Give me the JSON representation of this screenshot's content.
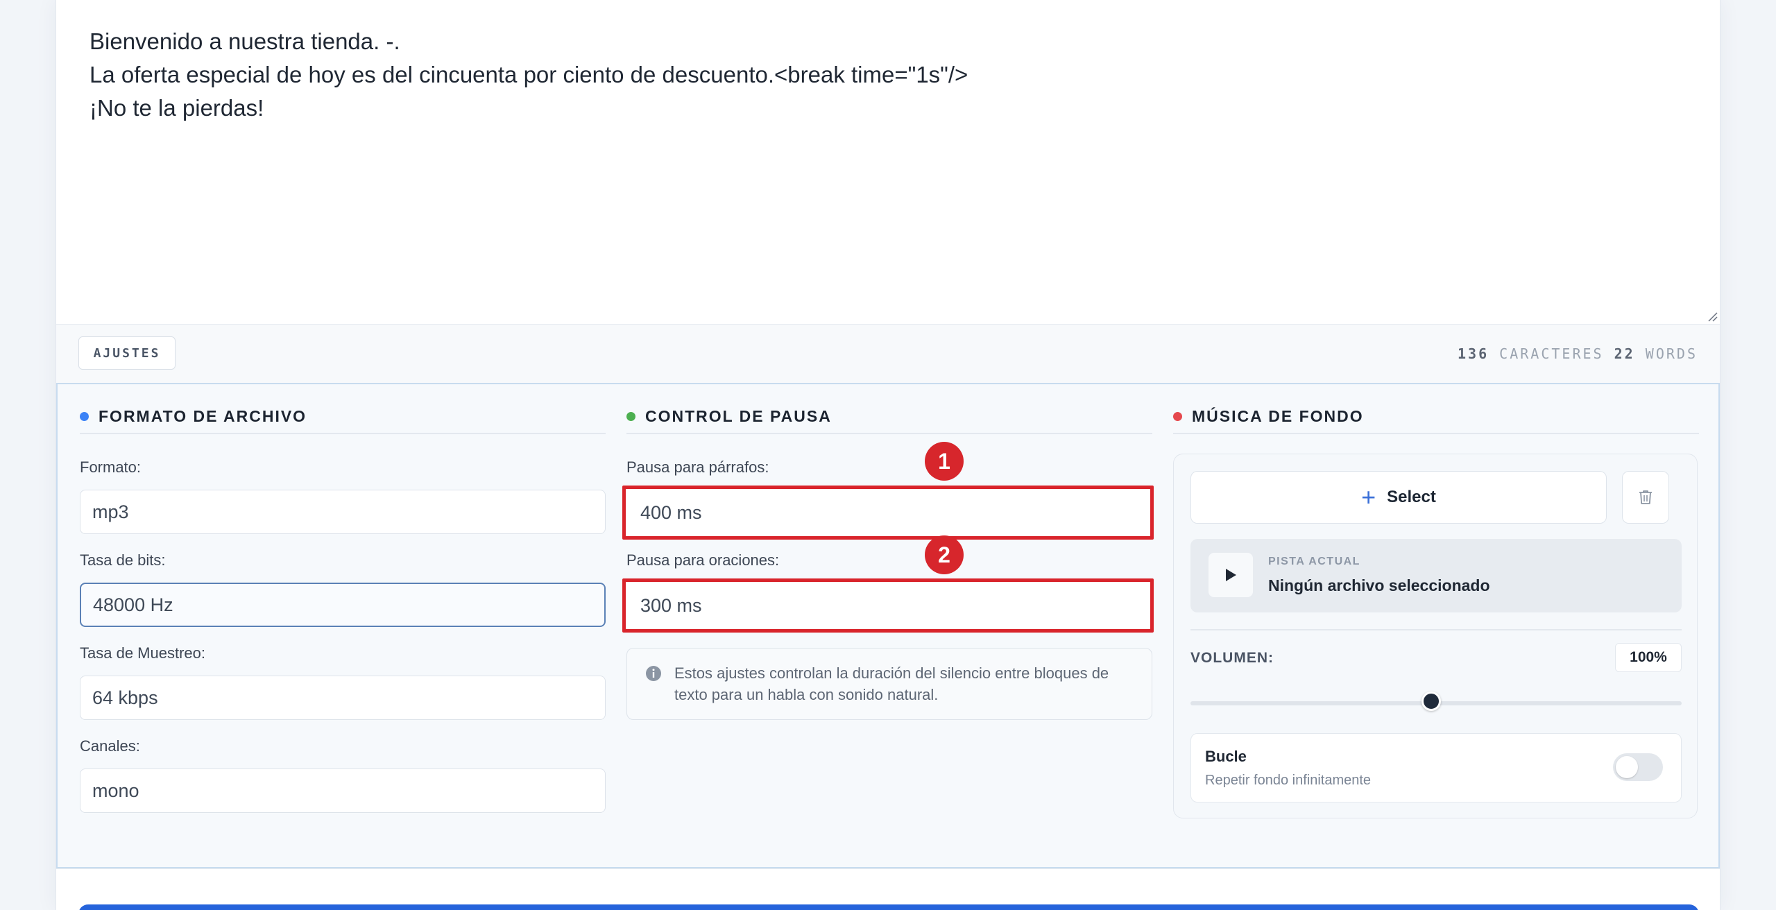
{
  "editor": {
    "lines": [
      "Bienvenido a nuestra tienda. -.",
      "La oferta especial de hoy es del cincuenta por ciento de descuento.<break time=\"1s\"/>",
      "¡No te la pierdas!"
    ]
  },
  "toolbar": {
    "settings_label": "AJUSTES",
    "char_count": "136",
    "char_label": "CARACTERES",
    "word_count": "22",
    "word_label": "WORDS"
  },
  "file_format": {
    "title": "FORMATO DE ARCHIVO",
    "accent": "#3b82f6",
    "format_label": "Formato:",
    "format_value": "mp3",
    "bitrate_label": "Tasa de bits:",
    "bitrate_value": "48000 Hz",
    "samplerate_label": "Tasa de Muestreo:",
    "samplerate_value": "64 kbps",
    "channels_label": "Canales:",
    "channels_value": "mono"
  },
  "pause_control": {
    "title": "CONTROL DE PAUSA",
    "accent": "#4caf50",
    "paragraph_label": "Pausa para párrafos:",
    "paragraph_value": "400 ms",
    "sentence_label": "Pausa para oraciones:",
    "sentence_value": "300 ms",
    "badge_1": "1",
    "badge_2": "2",
    "info_text": "Estos ajustes controlan la duración del silencio entre bloques de texto para un habla con sonido natural."
  },
  "background_music": {
    "title": "MÚSICA DE FONDO",
    "accent": "#e5484d",
    "select_label": "Select",
    "track_tag": "PISTA ACTUAL",
    "track_name": "Ningún archivo seleccionado",
    "volume_label": "VOLUMEN:",
    "volume_value": "100%",
    "volume_slider_fraction": 0.49,
    "loop_title": "Bucle",
    "loop_subtitle": "Repetir fondo infinitamente",
    "loop_enabled": false
  },
  "icons": {
    "info": "info-circle-icon",
    "trash": "trash-icon",
    "play": "play-icon",
    "plus": "plus-icon"
  }
}
